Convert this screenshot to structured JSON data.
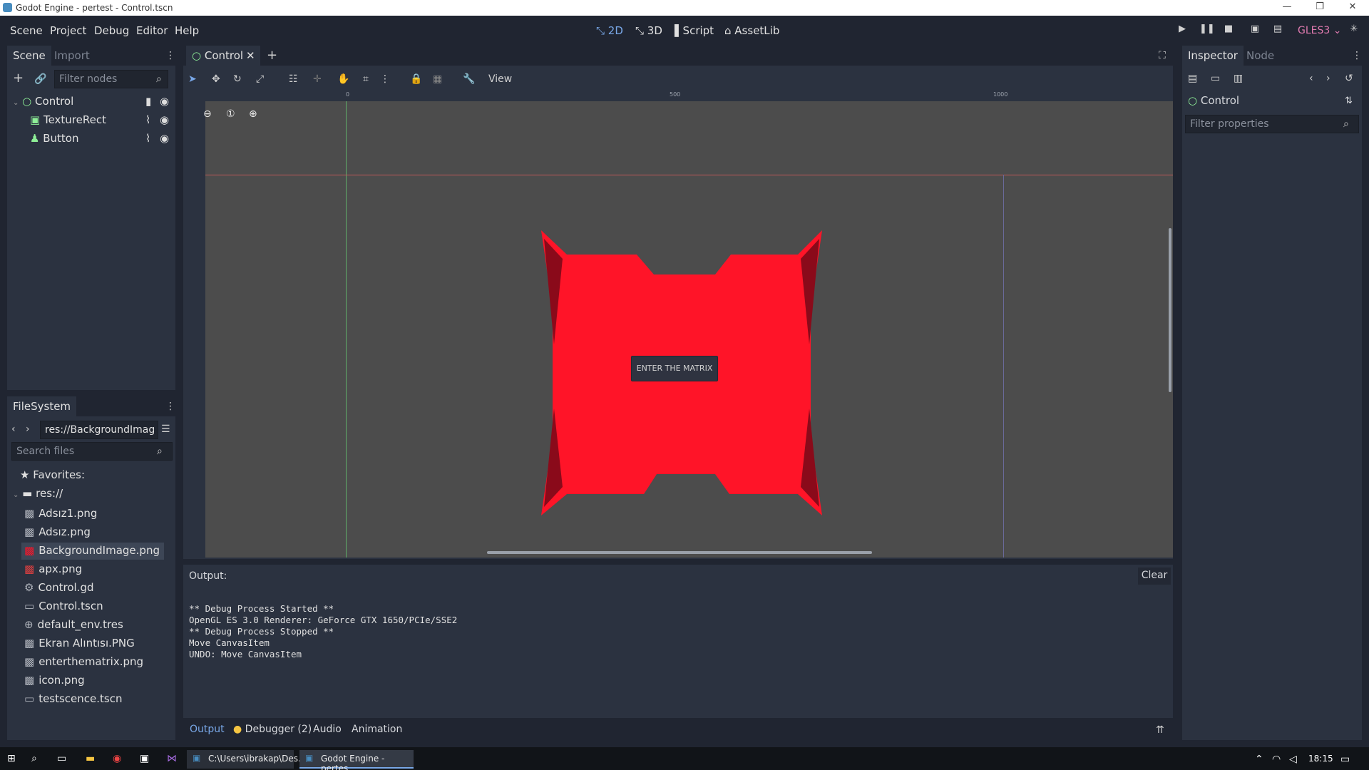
{
  "window": {
    "title": "Godot Engine - pertest - Control.tscn"
  },
  "menus": [
    "Scene",
    "Project",
    "Debug",
    "Editor",
    "Help"
  ],
  "modes": [
    {
      "label": "2D",
      "icon": "2d-icon",
      "active": true
    },
    {
      "label": "3D",
      "icon": "3d-icon",
      "active": false
    },
    {
      "label": "Script",
      "icon": "script-icon",
      "active": false
    },
    {
      "label": "AssetLib",
      "icon": "assetlib-icon",
      "active": false
    }
  ],
  "renderer": "GLES3",
  "scene_dock": {
    "tabs": [
      "Scene",
      "Import"
    ],
    "filter_placeholder": "Filter nodes",
    "nodes": [
      {
        "label": "Control",
        "icon": "control-node-icon",
        "depth": 0
      },
      {
        "label": "TextureRect",
        "icon": "texturerect-node-icon",
        "depth": 1
      },
      {
        "label": "Button",
        "icon": "button-node-icon",
        "depth": 1
      }
    ]
  },
  "filesystem_dock": {
    "title": "FileSystem",
    "path": "res://BackgroundImag",
    "search_placeholder": "Search files",
    "favorites_label": "Favorites:",
    "root_label": "res://",
    "files": [
      {
        "name": "Adsız1.png",
        "icon": "image-file-icon",
        "selected": false
      },
      {
        "name": "Adsız.png",
        "icon": "image-file-icon",
        "selected": false
      },
      {
        "name": "BackgroundImage.png",
        "icon": "image-file-icon",
        "selected": true
      },
      {
        "name": "apx.png",
        "icon": "image-file-icon",
        "selected": false
      },
      {
        "name": "Control.gd",
        "icon": "script-file-icon",
        "selected": false
      },
      {
        "name": "Control.tscn",
        "icon": "scene-file-icon",
        "selected": false
      },
      {
        "name": "default_env.tres",
        "icon": "environment-file-icon",
        "selected": false
      },
      {
        "name": "Ekran Alıntısı.PNG",
        "icon": "image-file-icon",
        "selected": false
      },
      {
        "name": "enterthematrix.png",
        "icon": "image-file-icon",
        "selected": false
      },
      {
        "name": "icon.png",
        "icon": "image-file-icon",
        "selected": false
      },
      {
        "name": "testscence.tscn",
        "icon": "scene-file-icon",
        "selected": false
      }
    ]
  },
  "editor": {
    "scene_tab": "Control",
    "view_menu": "View",
    "ruler_labels": [
      "0",
      "500",
      "1000"
    ],
    "button_text": "ENTER THE MATRIX",
    "shape_color": "#ff1428"
  },
  "output": {
    "label": "Output:",
    "clear_label": "Clear",
    "lines": [
      "** Debug Process Started **",
      "OpenGL ES 3.0 Renderer: GeForce GTX 1650/PCIe/SSE2",
      "** Debug Process Stopped **",
      "Move CanvasItem",
      "UNDO: Move CanvasItem"
    ],
    "bottom_tabs": [
      "Output",
      "Debugger (2)",
      "Audio",
      "Animation"
    ]
  },
  "inspector": {
    "tabs": [
      "Inspector",
      "Node"
    ],
    "object_name": "Control",
    "filter_placeholder": "Filter properties"
  },
  "taskbar": {
    "apps": [
      "C:\\Users\\ibrakap\\Des...",
      "Godot Engine - pertes..."
    ],
    "time": "18:15"
  },
  "colors": {
    "accent": "#79a8e8",
    "panel": "#2b3240",
    "background": "#202531",
    "selection": "#3d4656"
  }
}
